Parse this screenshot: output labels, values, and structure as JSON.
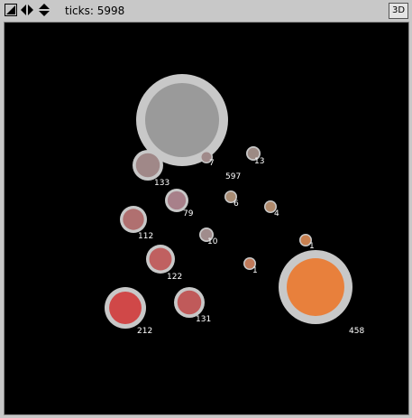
{
  "toolbar": {
    "ticks_label": "ticks: 5998",
    "button_3d": "3D",
    "icons": [
      "rotate-icon",
      "move-icon",
      "zoom-icon"
    ]
  },
  "world": {
    "background": "#000000",
    "ring_color": "#c8c8c8",
    "nodes": [
      {
        "label": "597",
        "color": "#9a9a9a"
      },
      {
        "label": "133",
        "color": "#a08888"
      },
      {
        "label": "7",
        "color": "#a08a8a"
      },
      {
        "label": "13",
        "color": "#9c8a84"
      },
      {
        "label": "79",
        "color": "#a8808a"
      },
      {
        "label": "6",
        "color": "#a88c74"
      },
      {
        "label": "4",
        "color": "#b08a6c"
      },
      {
        "label": "112",
        "color": "#b07070"
      },
      {
        "label": "10",
        "color": "#a08c8c"
      },
      {
        "label": "1",
        "color": "#c88050"
      },
      {
        "label": "122",
        "color": "#c06060"
      },
      {
        "label": "1",
        "color": "#c07a5a"
      },
      {
        "label": "131",
        "color": "#c05a5a"
      },
      {
        "label": "212",
        "color": "#d04848"
      },
      {
        "label": "458",
        "color": "#e8803c"
      }
    ]
  }
}
